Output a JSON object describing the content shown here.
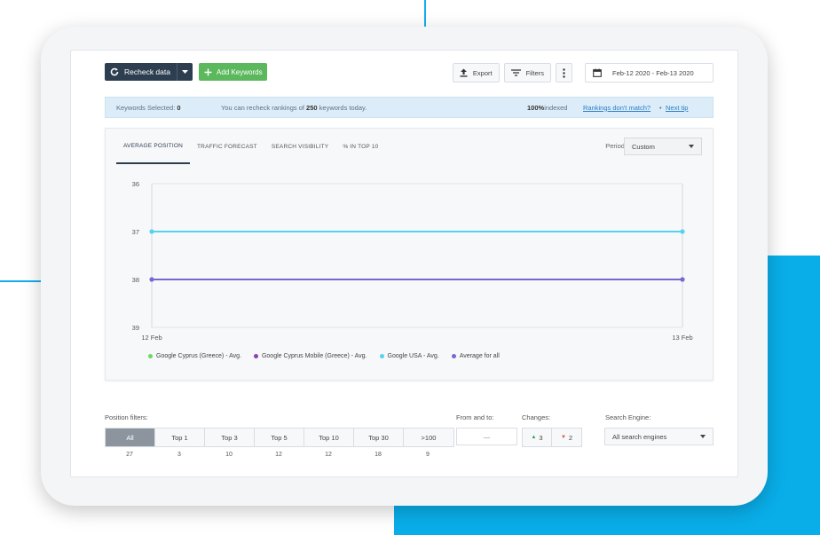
{
  "toolbar": {
    "recheck_label": "Recheck data",
    "add_keywords_label": "Add Keywords",
    "export_label": "Export",
    "filters_label": "Filters",
    "date_range": "Feb-12 2020 - Feb-13 2020"
  },
  "info_bar": {
    "selected_label": "Keywords Selected:",
    "selected_count": "0",
    "recheck_prefix": "You can recheck rankings of",
    "recheck_count": "250",
    "recheck_suffix": "keywords today.",
    "indexed_value": "100%",
    "indexed_label": "indexed",
    "mismatch_link": "Rankings don't match?",
    "separator": "•",
    "next_tip_link": "Next tip"
  },
  "chart_tabs": [
    "AVERAGE POSITION",
    "TRAFFIC FORECAST",
    "SEARCH VISIBILITY",
    "% IN TOP 10"
  ],
  "period": {
    "label": "Period:",
    "value": "Custom"
  },
  "chart_data": {
    "type": "line",
    "x": [
      "12 Feb",
      "13 Feb"
    ],
    "y_ticks": [
      36,
      37,
      38,
      39
    ],
    "ylim": [
      36,
      39
    ],
    "y_inverted": true,
    "grid": true,
    "legend_position": "bottom",
    "series": [
      {
        "name": "Google Cyprus (Greece) - Avg.",
        "color": "#6cd965",
        "values": [
          null,
          null
        ]
      },
      {
        "name": "Google Cyprus Mobile (Greece) - Avg.",
        "color": "#8f3eb5",
        "values": [
          null,
          null
        ]
      },
      {
        "name": "Google USA - Avg.",
        "color": "#55d2ef",
        "values": [
          37,
          37
        ]
      },
      {
        "name": "Average for all",
        "color": "#7b66d1",
        "values": [
          38,
          38
        ]
      }
    ]
  },
  "filters": {
    "position_label": "Position filters:",
    "positions": [
      {
        "label": "All",
        "count": "27"
      },
      {
        "label": "Top 1",
        "count": "3"
      },
      {
        "label": "Top 3",
        "count": "10"
      },
      {
        "label": "Top 5",
        "count": "12"
      },
      {
        "label": "Top 10",
        "count": "12"
      },
      {
        "label": "Top 30",
        "count": "18"
      },
      {
        "label": ">100",
        "count": "9"
      }
    ],
    "range_label": "From and to:",
    "range_value": "—",
    "changes_label": "Changes:",
    "changes_up": "3",
    "changes_down": "2",
    "engine_label": "Search Engine:",
    "engine_value": "All search engines"
  },
  "icons": {
    "up_glyph": "▲",
    "down_glyph": "▼"
  }
}
